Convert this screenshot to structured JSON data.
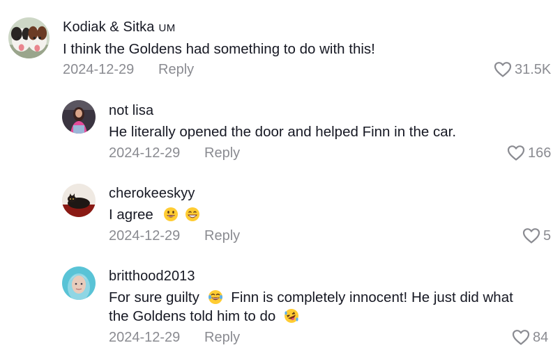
{
  "comments": [
    {
      "username": "Kodiak & Sitka",
      "badge": "UM",
      "text": "I think the Goldens had something to do with this!",
      "date": "2024-12-29",
      "reply_label": "Reply",
      "likes": "31.5K"
    },
    {
      "username": "not lisa",
      "text": "He literally opened the door and helped Finn in the car.",
      "date": "2024-12-29",
      "reply_label": "Reply",
      "likes": "166"
    },
    {
      "username": "cherokeeskyy",
      "text": "I agree",
      "emojis": [
        "grinning-face-emoji",
        "beaming-face-emoji"
      ],
      "date": "2024-12-29",
      "reply_label": "Reply",
      "likes": "5"
    },
    {
      "username": "britthood2013",
      "text_line1_a": "For sure guilty",
      "text_line1_b": "Finn is completely innocent! He just did what",
      "text_line2": "the Goldens told him to do",
      "emojis": [
        "laughing-tears-emoji",
        "rolling-laughing-emoji"
      ],
      "date": "2024-12-29",
      "reply_label": "Reply",
      "likes": "84"
    }
  ],
  "colors": {
    "text_primary": "#161823",
    "text_secondary": "#8a8b91",
    "emoji_yellow": "#ffcc33"
  },
  "icons": {
    "like": "heart-outline-icon"
  }
}
